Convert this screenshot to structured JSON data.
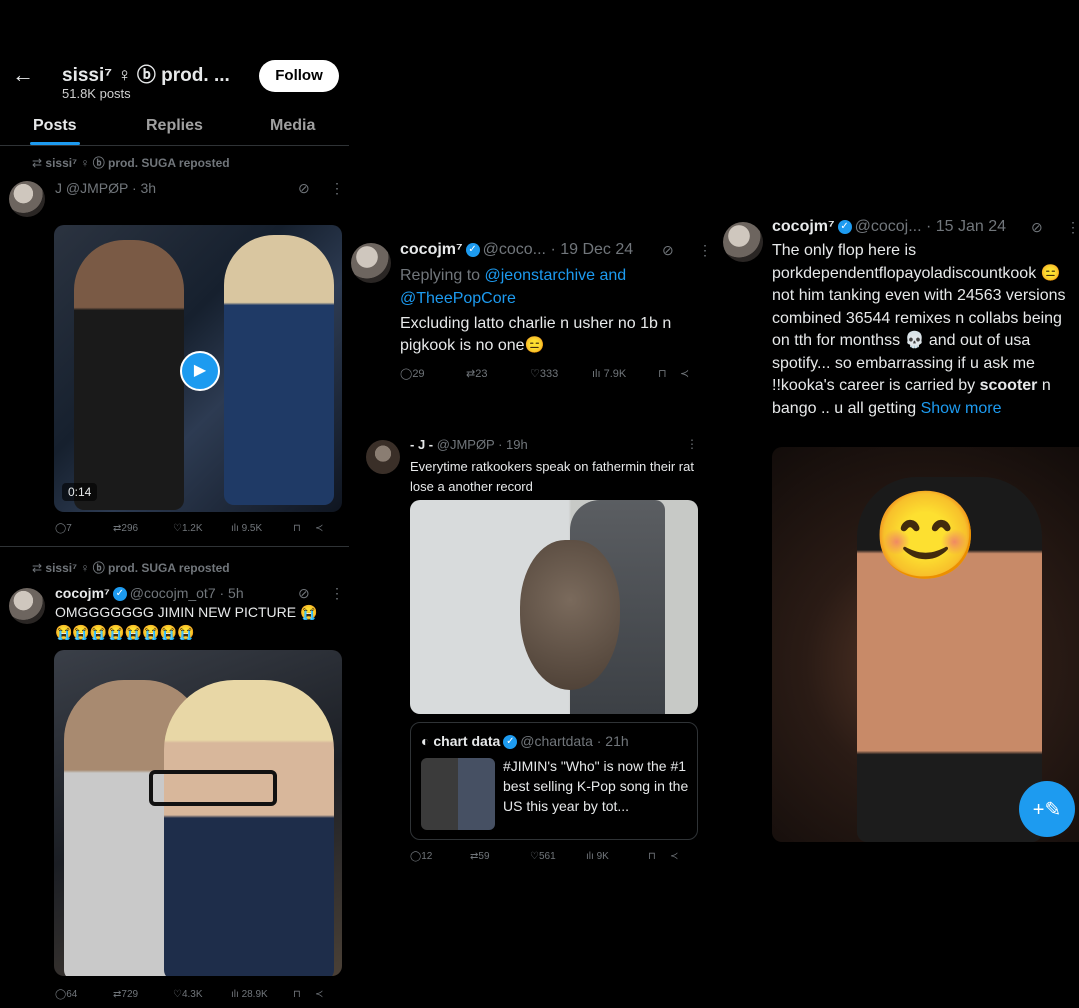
{
  "header": {
    "back_icon": "arrow-left-icon",
    "name": "sissi⁷ ♀ ⓑ prod. ...",
    "posts_count": "51.8K posts",
    "follow_label": "Follow"
  },
  "tabs": [
    {
      "label": "Posts"
    },
    {
      "label": "Replies"
    },
    {
      "label": "Media"
    }
  ],
  "left": {
    "repost1": "sissi⁷ ♀ ⓑ prod. SUGA reposted",
    "post1_handle": "J @JMPØP · 3h",
    "post1_duration": "0:14",
    "post1_actions": {
      "replies": "7",
      "reposts": "296",
      "likes": "1.2K",
      "views": "9.5K"
    },
    "repost2": "sissi⁷ ♀ ⓑ prod. SUGA reposted",
    "post2_name": "cocojm⁷",
    "post2_handle": "@cocojm_ot7 · 5h",
    "post2_text": "OMGGGGGGG JIMIN NEW PICTURE 😭",
    "post2_emojis": "😭😭😭😭😭😭😭😭",
    "post2_actions": {
      "replies": "64",
      "reposts": "729",
      "likes": "4.3K",
      "views": "28.9K"
    }
  },
  "middle": {
    "post1_name": "cocojm⁷",
    "post1_handle": "@coco... · 19 Dec 24",
    "post1_reply_prefix": "Replying to",
    "post1_reply_to": "@jeonstarchive and",
    "post1_reply_to2": "@TheePopCore",
    "post1_text": "Excluding latto charlie n usher no 1b n pigkook is no one😑",
    "post1_actions": {
      "replies": "29",
      "reposts": "23",
      "likes": "333",
      "views": "7.9K"
    },
    "post2_name": "- J -",
    "post2_handle": "@JMPØP · 19h",
    "post2_text": "Everytime ratkookers speak on fathermin their rat lose a another record",
    "quote_name": "chart data",
    "quote_handle": "@chartdata · 21h",
    "quote_text": "#JIMIN's \"Who\" is now the #1 best selling K-Pop song in the US this year by tot...",
    "post2_actions": {
      "replies": "12",
      "reposts": "59",
      "likes": "561",
      "views": "9K"
    }
  },
  "right": {
    "name": "cocojm⁷",
    "handle": "@cocoj... · 15 Jan 24",
    "text_pre": "The only flop here is porkdependentflopayoladiscountkook 😑not him tanking even with 24563 versions combined 36544 remixes n collabs being on tth for monthss 💀 and out of usa spotify... so embarrassing if u ask me !!kooka's career is carried by",
    "text_bold": "scooter",
    "text_post": "n bango .. u all getting",
    "show_more": "Show more",
    "emoji_cover": "😊",
    "fab_icon": "compose-icon",
    "fab_glyph": "+✎"
  },
  "colors": {
    "accent": "#1d9bf0",
    "bg": "#000000",
    "text": "#e7e9ea",
    "muted": "#71767b"
  }
}
